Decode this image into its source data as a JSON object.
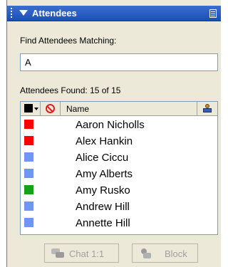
{
  "header": {
    "title": "Attendees"
  },
  "search": {
    "label": "Find Attendees Matching:",
    "value": "A"
  },
  "summary": {
    "label": "Attendees Found:",
    "count": "15 of 15"
  },
  "list": {
    "columns": {
      "name": "Name"
    },
    "rows": [
      {
        "name": "Aaron Nicholls",
        "color": "#ff0000"
      },
      {
        "name": "Alex Hankin",
        "color": "#ff0000"
      },
      {
        "name": "Alice Ciccu",
        "color": "#6f96f2"
      },
      {
        "name": "Amy Alberts",
        "color": "#6f96f2"
      },
      {
        "name": "Amy Rusko",
        "color": "#16a116"
      },
      {
        "name": "Andrew Hill",
        "color": "#6f96f2"
      },
      {
        "name": "Annette Hill",
        "color": "#6f96f2"
      }
    ]
  },
  "buttons": {
    "chat": "Chat 1:1",
    "block": "Block"
  }
}
